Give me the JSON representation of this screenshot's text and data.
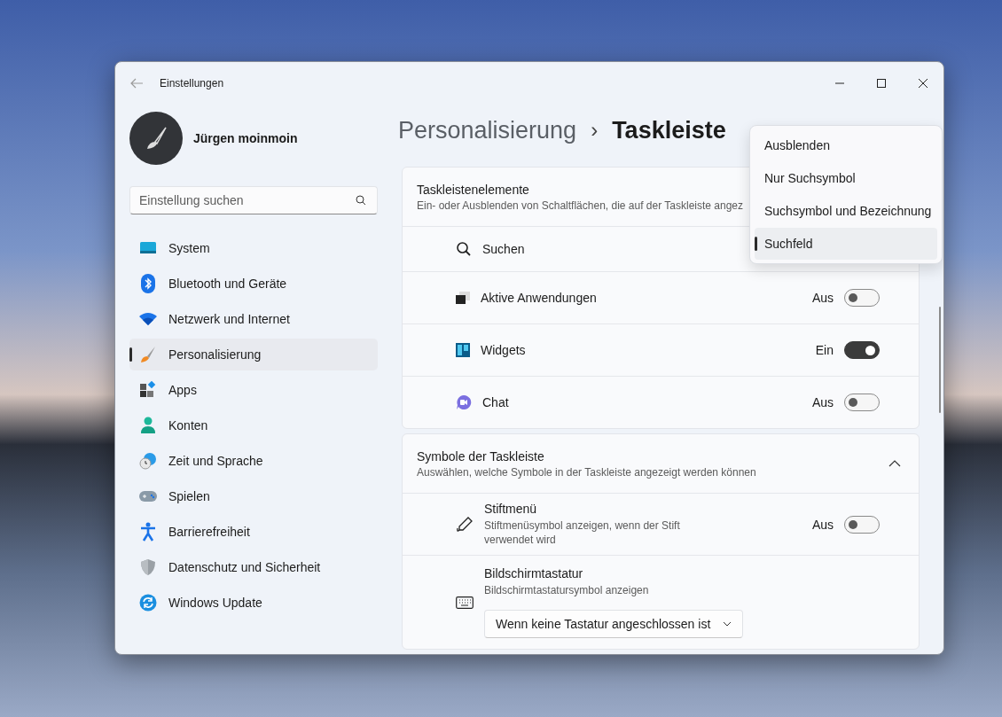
{
  "window": {
    "title": "Einstellungen"
  },
  "account": {
    "name": "Jürgen moinmoin"
  },
  "search": {
    "placeholder": "Einstellung suchen"
  },
  "sidebar": {
    "items": [
      {
        "label": "System",
        "selected": false
      },
      {
        "label": "Bluetooth und Geräte",
        "selected": false
      },
      {
        "label": "Netzwerk und Internet",
        "selected": false
      },
      {
        "label": "Personalisierung",
        "selected": true
      },
      {
        "label": "Apps",
        "selected": false
      },
      {
        "label": "Konten",
        "selected": false
      },
      {
        "label": "Zeit und Sprache",
        "selected": false
      },
      {
        "label": "Spielen",
        "selected": false
      },
      {
        "label": "Barrierefreiheit",
        "selected": false
      },
      {
        "label": "Datenschutz und Sicherheit",
        "selected": false
      },
      {
        "label": "Windows Update",
        "selected": false
      }
    ]
  },
  "breadcrumb": {
    "parent": "Personalisierung",
    "separator": "›",
    "current": "Taskleiste"
  },
  "sections": [
    {
      "title": "Taskleistenelemente",
      "subtitle": "Ein- oder Ausblenden von Schaltflächen, die auf der Taskleiste angez",
      "rows": [
        {
          "kind": "dropdown",
          "label": "Suchen",
          "expanded": true,
          "options": [
            {
              "label": "Ausblenden",
              "selected": false
            },
            {
              "label": "Nur Suchsymbol",
              "selected": false
            },
            {
              "label": "Suchsymbol und Bezeichnung",
              "selected": false
            },
            {
              "label": "Suchfeld",
              "selected": true
            }
          ]
        },
        {
          "kind": "toggle",
          "label": "Aktive Anwendungen",
          "state_text": "Aus",
          "on": false
        },
        {
          "kind": "toggle",
          "label": "Widgets",
          "state_text": "Ein",
          "on": true
        },
        {
          "kind": "toggle",
          "label": "Chat",
          "state_text": "Aus",
          "on": false
        }
      ]
    },
    {
      "title": "Symbole der Taskleiste",
      "subtitle": "Auswählen, welche Symbole in der Taskleiste angezeigt werden können",
      "expanded": true,
      "rows": [
        {
          "kind": "toggle",
          "label": "Stiftmenü",
          "description": "Stiftmenüsymbol anzeigen, wenn der Stift verwendet wird",
          "state_text": "Aus",
          "on": false
        },
        {
          "kind": "select",
          "label": "Bildschirmtastatur",
          "description": "Bildschirmtastatursymbol anzeigen",
          "value": "Wenn keine Tastatur angeschlossen ist"
        }
      ]
    }
  ]
}
